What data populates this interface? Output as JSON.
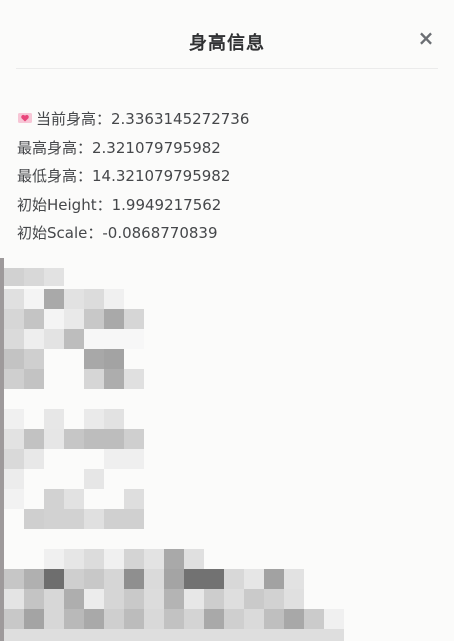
{
  "dialog": {
    "title": "身高信息",
    "close_symbol": "×"
  },
  "info": {
    "current_height": "当前身高：2.3363145272736",
    "max_height": "最高身高：2.321079795982",
    "min_height": "最低身高：14.321079795982",
    "initial_height": "初始Height：1.9949217562",
    "initial_scale": "初始Scale：-0.0868770839"
  },
  "icons": {
    "heart": "heart-letter-icon"
  },
  "colors": {
    "accent_heart": "#e8457a"
  }
}
